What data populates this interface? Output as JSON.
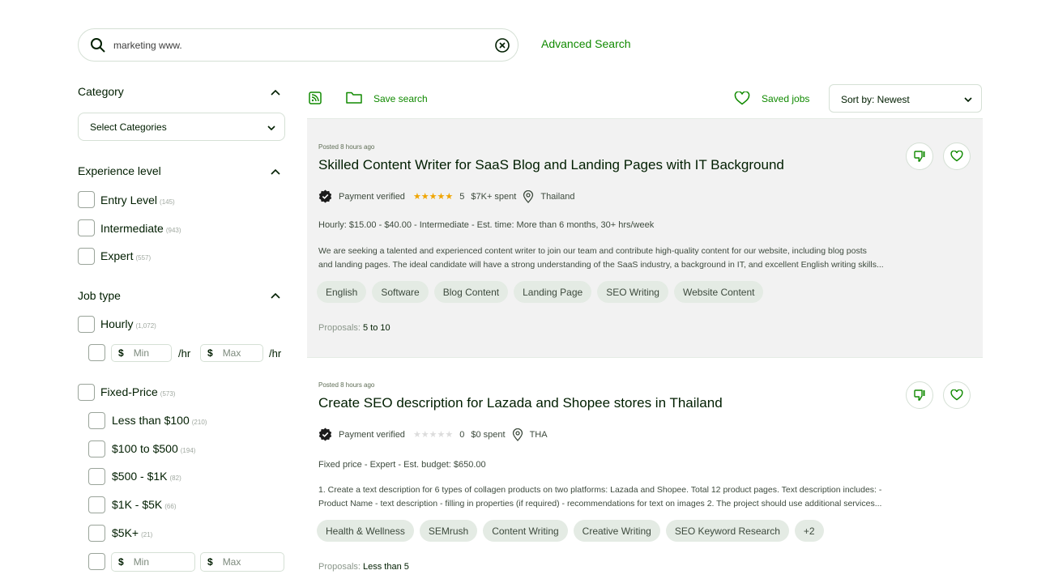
{
  "search": {
    "value": "marketing www.",
    "advanced_label": "Advanced Search"
  },
  "sidebar": {
    "category": {
      "title": "Category",
      "select_label": "Select Categories"
    },
    "experience": {
      "title": "Experience level",
      "items": [
        {
          "label": "Entry Level",
          "count": "(145)"
        },
        {
          "label": "Intermediate",
          "count": "(943)"
        },
        {
          "label": "Expert",
          "count": "(557)"
        }
      ]
    },
    "job_type": {
      "title": "Job type",
      "hourly": {
        "label": "Hourly",
        "count": "(1,072)"
      },
      "hourly_rate": {
        "currency": "$",
        "min": "Min",
        "max": "Max",
        "unit": "/hr"
      },
      "fixed": {
        "label": "Fixed-Price",
        "count": "(573)"
      },
      "fixed_items": [
        {
          "label": "Less than $100",
          "count": "(210)"
        },
        {
          "label": "$100 to $500",
          "count": "(194)"
        },
        {
          "label": "$500 - $1K",
          "count": "(82)"
        },
        {
          "label": "$1K - $5K",
          "count": "(66)"
        },
        {
          "label": "$5K+",
          "count": "(21)"
        }
      ],
      "fixed_range": {
        "currency": "$",
        "min": "Min",
        "max": "Max"
      }
    }
  },
  "toolbar": {
    "save_search": "Save search",
    "saved_jobs": "Saved jobs",
    "sort": "Sort by: Newest"
  },
  "jobs": [
    {
      "posted": "Posted 8 hours ago",
      "title": "Skilled Content Writer for SaaS Blog and Landing Pages with IT Background",
      "payment": "Payment verified",
      "stars": "★★★★★",
      "rating": "5",
      "spent": "$7K+ spent",
      "location": "Thailand",
      "terms": "Hourly: $15.00 - $40.00 - Intermediate - Est. time: More than 6 months, 30+ hrs/week",
      "desc1": "We are seeking a talented and experienced content writer to join our team and contribute high-quality content for our website, including blog posts",
      "desc2": "and landing pages. The ideal candidate will have a strong understanding of the SaaS industry, a background in IT, and excellent English writing skills...",
      "tags": [
        "English",
        "Software",
        "Blog Content",
        "Landing Page",
        "SEO Writing",
        "Website Content"
      ],
      "proposals_label": "Proposals:",
      "proposals": "5 to 10"
    },
    {
      "posted": "Posted 8 hours ago",
      "title": "Create SEO description for Lazada and Shopee stores in Thailand",
      "payment": "Payment verified",
      "stars": "★★★★★",
      "rating": "0",
      "spent": "$0 spent",
      "location": "THA",
      "terms": "Fixed price - Expert - Est. budget: $650.00",
      "desc1": "1. Create a text description for 6 types of collagen products on two platforms: Lazada and Shopee. Total 12 product pages. Text description includes: -",
      "desc2": "Product Name - text description - filling in properties (if required) - recommendations for text on images 2. The project should use additional services...",
      "tags": [
        "Health & Wellness",
        "SEMrush",
        "Content Writing",
        "Creative Writing",
        "SEO Keyword Research",
        "+2"
      ],
      "proposals_label": "Proposals:",
      "proposals": "Less than 5"
    }
  ],
  "colors": {
    "accent": "#108a00",
    "star": "#f0a500",
    "tag_bg": "#e4ebe4",
    "highlight_bg": "#f2f2f2"
  }
}
